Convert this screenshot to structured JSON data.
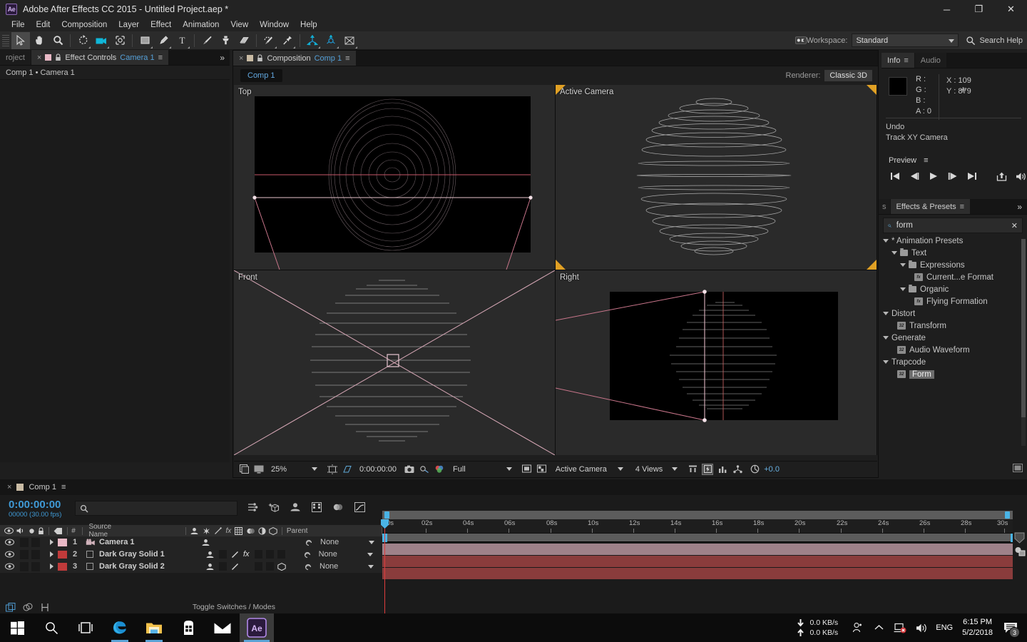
{
  "window": {
    "title": "Adobe After Effects CC 2015 - Untitled Project.aep *",
    "logo_text": "Ae",
    "minimize": "─",
    "maximize": "❐",
    "close": "✕"
  },
  "menu": [
    "File",
    "Edit",
    "Composition",
    "Layer",
    "Effect",
    "Animation",
    "View",
    "Window",
    "Help"
  ],
  "toolbar": {
    "tools": [
      {
        "name": "selection-tool",
        "icon": "arrow"
      },
      {
        "name": "hand-tool",
        "icon": "hand"
      },
      {
        "name": "zoom-tool",
        "icon": "magnifier"
      },
      {
        "name": "rotation-tool",
        "icon": "rotate"
      },
      {
        "name": "camera-tool",
        "icon": "camera"
      },
      {
        "name": "pan-behind-tool",
        "icon": "anchor-point"
      },
      {
        "name": "shape-tool",
        "icon": "rectangle"
      },
      {
        "name": "pen-tool",
        "icon": "pen"
      },
      {
        "name": "type-tool",
        "icon": "text-T"
      },
      {
        "name": "brush-tool",
        "icon": "brush"
      },
      {
        "name": "clone-stamp-tool",
        "icon": "stamp"
      },
      {
        "name": "eraser-tool",
        "icon": "eraser"
      },
      {
        "name": "roto-brush-tool",
        "icon": "roto-brush"
      },
      {
        "name": "puppet-pin-tool",
        "icon": "pin"
      },
      {
        "name": "unified-camera-tool",
        "icon": "axis"
      },
      {
        "name": "orbit-camera-tool",
        "icon": "orbit"
      },
      {
        "name": "pan-camera-tool",
        "icon": "pan-cam"
      }
    ],
    "workspace_label": "Workspace:",
    "workspace_value": "Standard",
    "search_help": "Search Help"
  },
  "effect_controls": {
    "tab_project": "roject",
    "tab_label": "Effect Controls",
    "tab_target": "Camera 1",
    "path": "Comp 1 • Camera 1",
    "close_x": "×",
    "menu_glyph": "≡",
    "chevron": "»"
  },
  "composition": {
    "tab_label": "Composition",
    "tab_target": "Comp 1",
    "comp_chip": "Comp 1",
    "renderer_label": "Renderer:",
    "renderer_value": "Classic 3D",
    "views": [
      {
        "name": "top-view",
        "label": "Top"
      },
      {
        "name": "active-camera-view",
        "label": "Active Camera"
      },
      {
        "name": "front-view",
        "label": "Front"
      },
      {
        "name": "right-view",
        "label": "Right"
      }
    ],
    "toolbar": {
      "zoom": "25%",
      "timecode": "0:00:00:00",
      "resolution": "Full",
      "view_layout": "Active Camera",
      "views_count": "4 Views",
      "exposure": "+0.0"
    }
  },
  "info": {
    "tab_info": "Info",
    "tab_audio": "Audio",
    "r_label": "R :",
    "g_label": "G :",
    "b_label": "B :",
    "a_label": "A :",
    "a_value": "0",
    "x_value": "X : 109",
    "y_value": "Y : 879",
    "undo_label": "Undo",
    "undo_action": "Track XY Camera"
  },
  "preview": {
    "title": "Preview",
    "buttons": [
      "first-frame",
      "prev-frame",
      "play",
      "next-frame",
      "last-frame",
      "ram-preview",
      "audio-toggle"
    ]
  },
  "effects_presets": {
    "tab_truncated": "s",
    "tab_label": "Effects & Presets",
    "search_value": "form",
    "search_placeholder": "",
    "clear_glyph": "✕",
    "tree": [
      {
        "label": "* Animation Presets",
        "depth": 0,
        "type": "group",
        "expanded": true
      },
      {
        "label": "Text",
        "depth": 1,
        "type": "folder",
        "expanded": true
      },
      {
        "label": "Expressions",
        "depth": 2,
        "type": "folder",
        "expanded": true
      },
      {
        "label": "Current...e Format",
        "depth": 3,
        "type": "preset",
        "expanded": false
      },
      {
        "label": "Organic",
        "depth": 2,
        "type": "folder",
        "expanded": true
      },
      {
        "label": "Flying Formation",
        "depth": 3,
        "type": "preset",
        "expanded": false
      },
      {
        "label": "Distort",
        "depth": 0,
        "type": "group",
        "expanded": true
      },
      {
        "label": "Transform",
        "depth": 1,
        "type": "effect",
        "expanded": false
      },
      {
        "label": "Generate",
        "depth": 0,
        "type": "group",
        "expanded": true
      },
      {
        "label": "Audio Waveform",
        "depth": 1,
        "type": "effect",
        "expanded": false
      },
      {
        "label": "Trapcode",
        "depth": 0,
        "type": "group",
        "expanded": true
      },
      {
        "label": "Form",
        "depth": 1,
        "type": "effect",
        "expanded": false,
        "selected": true
      }
    ]
  },
  "timeline": {
    "tab_label": "Comp 1",
    "timecode": "0:00:00:00",
    "frame_info": "00000 (30.00 fps)",
    "search_placeholder": "",
    "search_value": "",
    "columns": [
      "#",
      "Source Name",
      "Parent"
    ],
    "layers": [
      {
        "index": "1",
        "name": "Camera 1",
        "parent": "None",
        "color": "#e9b9c6",
        "type": "camera",
        "switches": [
          "shy"
        ]
      },
      {
        "index": "2",
        "name": "Dark Gray Solid 1",
        "parent": "None",
        "color": "#c03a3a",
        "type": "solid",
        "switches": [
          "shy",
          "motion-blur",
          "fx"
        ]
      },
      {
        "index": "3",
        "name": "Dark Gray Solid 2",
        "parent": "None",
        "color": "#c03a3a",
        "type": "solid",
        "switches": [
          "shy",
          "motion-blur",
          "3d"
        ]
      }
    ],
    "footer_label": "Toggle Switches / Modes",
    "ruler_ticks": [
      "0s",
      "02s",
      "04s",
      "06s",
      "08s",
      "10s",
      "12s",
      "14s",
      "16s",
      "18s",
      "20s",
      "22s",
      "24s",
      "26s",
      "28s",
      "30s"
    ]
  },
  "taskbar": {
    "items": [
      {
        "name": "start-button",
        "icon": "windows"
      },
      {
        "name": "search-button",
        "icon": "magnifier"
      },
      {
        "name": "task-view-button",
        "icon": "taskview"
      },
      {
        "name": "edge-browser",
        "icon": "edge"
      },
      {
        "name": "file-explorer",
        "icon": "folder"
      },
      {
        "name": "microsoft-store",
        "icon": "store"
      },
      {
        "name": "mail-app",
        "icon": "mail"
      },
      {
        "name": "after-effects-app",
        "icon": "ae"
      }
    ],
    "download_speed": "0.0 KB/s",
    "upload_speed": "0.0 KB/s",
    "language": "ENG",
    "time": "6:15 PM",
    "date": "5/2/2018",
    "notification_count": "3"
  }
}
